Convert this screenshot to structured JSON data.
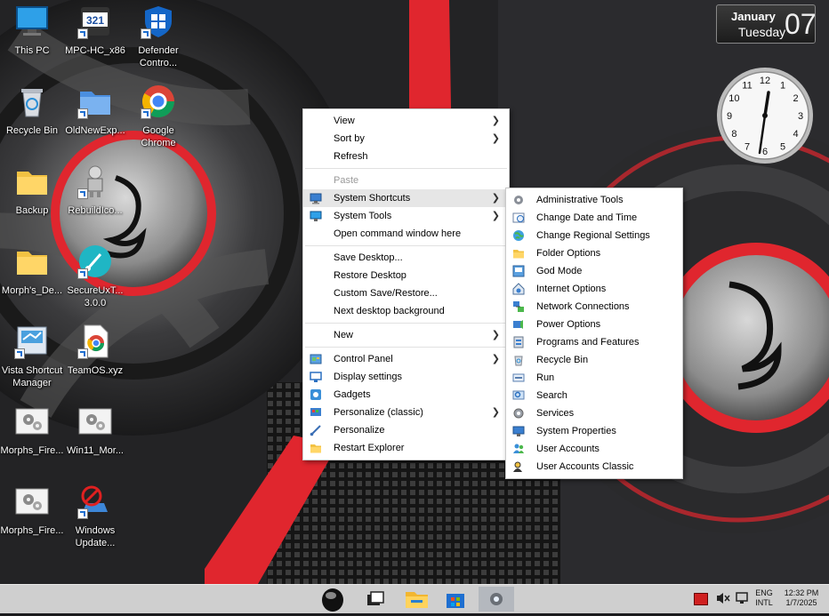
{
  "desktop": {
    "icons": [
      {
        "label": "This PC",
        "icon": "monitor-icon"
      },
      {
        "label": "MPC-HC_x86",
        "icon": "mpc-hc-icon"
      },
      {
        "label": "Defender Contro...",
        "icon": "defender-icon"
      },
      {
        "label": "Recycle Bin",
        "icon": "recycle-bin-icon"
      },
      {
        "label": "OldNewExp...",
        "icon": "folder-icon"
      },
      {
        "label": "Google Chrome",
        "icon": "chrome-icon"
      },
      {
        "label": "Backup",
        "icon": "folder-icon"
      },
      {
        "label": "RebuildIco...",
        "icon": "robot-icon"
      },
      {
        "label": "Morph's_De...",
        "icon": "folder-icon"
      },
      {
        "label": "SecureUxT... 3.0.0",
        "icon": "brush-icon"
      },
      {
        "label": "Vista Shortcut Manager",
        "icon": "shortcut-manager-icon"
      },
      {
        "label": "TeamOS.xyz",
        "icon": "chrome-page-icon"
      },
      {
        "label": "Morphs_Fire...",
        "icon": "gears-icon"
      },
      {
        "label": "Win11_Mor...",
        "icon": "gears-icon"
      },
      {
        "label": "Morphs_Fire...",
        "icon": "gears-icon"
      },
      {
        "label": "Windows Update...",
        "icon": "windows-update-blocked-icon"
      }
    ]
  },
  "calendar": {
    "month": "January",
    "weekday": "Tuesday",
    "date": "07"
  },
  "clock": {
    "numbers": [
      "12",
      "1",
      "2",
      "3",
      "4",
      "5",
      "6",
      "7",
      "8",
      "9",
      "10",
      "11"
    ]
  },
  "context_menu": {
    "items": [
      {
        "label": "View",
        "submenu": true
      },
      {
        "label": "Sort by",
        "submenu": true
      },
      {
        "label": "Refresh"
      },
      {
        "label": "Paste",
        "disabled": true
      },
      {
        "label": "System Shortcuts",
        "submenu": true,
        "icon": "system-shortcuts-icon"
      },
      {
        "label": "System Tools",
        "submenu": true,
        "icon": "monitor-icon"
      },
      {
        "label": "Open command window here"
      },
      {
        "label": "Save Desktop..."
      },
      {
        "label": "Restore Desktop"
      },
      {
        "label": "Custom Save/Restore..."
      },
      {
        "label": "Next desktop background"
      },
      {
        "label": "New",
        "submenu": true
      },
      {
        "label": "Control Panel",
        "submenu": true,
        "icon": "control-panel-icon"
      },
      {
        "label": "Display settings",
        "icon": "display-settings-icon"
      },
      {
        "label": "Gadgets",
        "icon": "gadgets-icon"
      },
      {
        "label": "Personalize (classic)",
        "submenu": true,
        "icon": "personalize-classic-icon"
      },
      {
        "label": "Personalize",
        "icon": "brush-icon"
      },
      {
        "label": "Restart Explorer",
        "icon": "explorer-folder-icon"
      }
    ]
  },
  "submenu": {
    "items": [
      {
        "label": "Administrative Tools",
        "icon": "admin-tools-icon"
      },
      {
        "label": "Change Date and Time",
        "icon": "date-time-icon"
      },
      {
        "label": "Change Regional Settings",
        "icon": "globe-icon"
      },
      {
        "label": "Folder Options",
        "icon": "folder-options-icon"
      },
      {
        "label": "God Mode",
        "icon": "god-mode-icon"
      },
      {
        "label": "Internet Options",
        "icon": "internet-options-icon"
      },
      {
        "label": "Network Connections",
        "icon": "network-icon"
      },
      {
        "label": "Power Options",
        "icon": "power-options-icon"
      },
      {
        "label": "Programs and Features",
        "icon": "programs-icon"
      },
      {
        "label": "Recycle Bin",
        "icon": "recycle-bin-icon"
      },
      {
        "label": "Run",
        "icon": "run-icon"
      },
      {
        "label": "Search",
        "icon": "search-icon"
      },
      {
        "label": "Services",
        "icon": "services-gear-icon"
      },
      {
        "label": "System Properties",
        "icon": "system-properties-icon"
      },
      {
        "label": "User Accounts",
        "icon": "user-accounts-icon"
      },
      {
        "label": "User Accounts Classic",
        "icon": "user-accounts-classic-icon"
      }
    ]
  },
  "taskbar": {
    "language": "ENG",
    "layout": "INTL",
    "time": "12:32 PM",
    "date": "1/7/2025"
  },
  "colors": {
    "menu_highlight": "#e6e6e6",
    "taskbar": "#cfcfcf",
    "wallpaper_red": "#e0262e"
  }
}
